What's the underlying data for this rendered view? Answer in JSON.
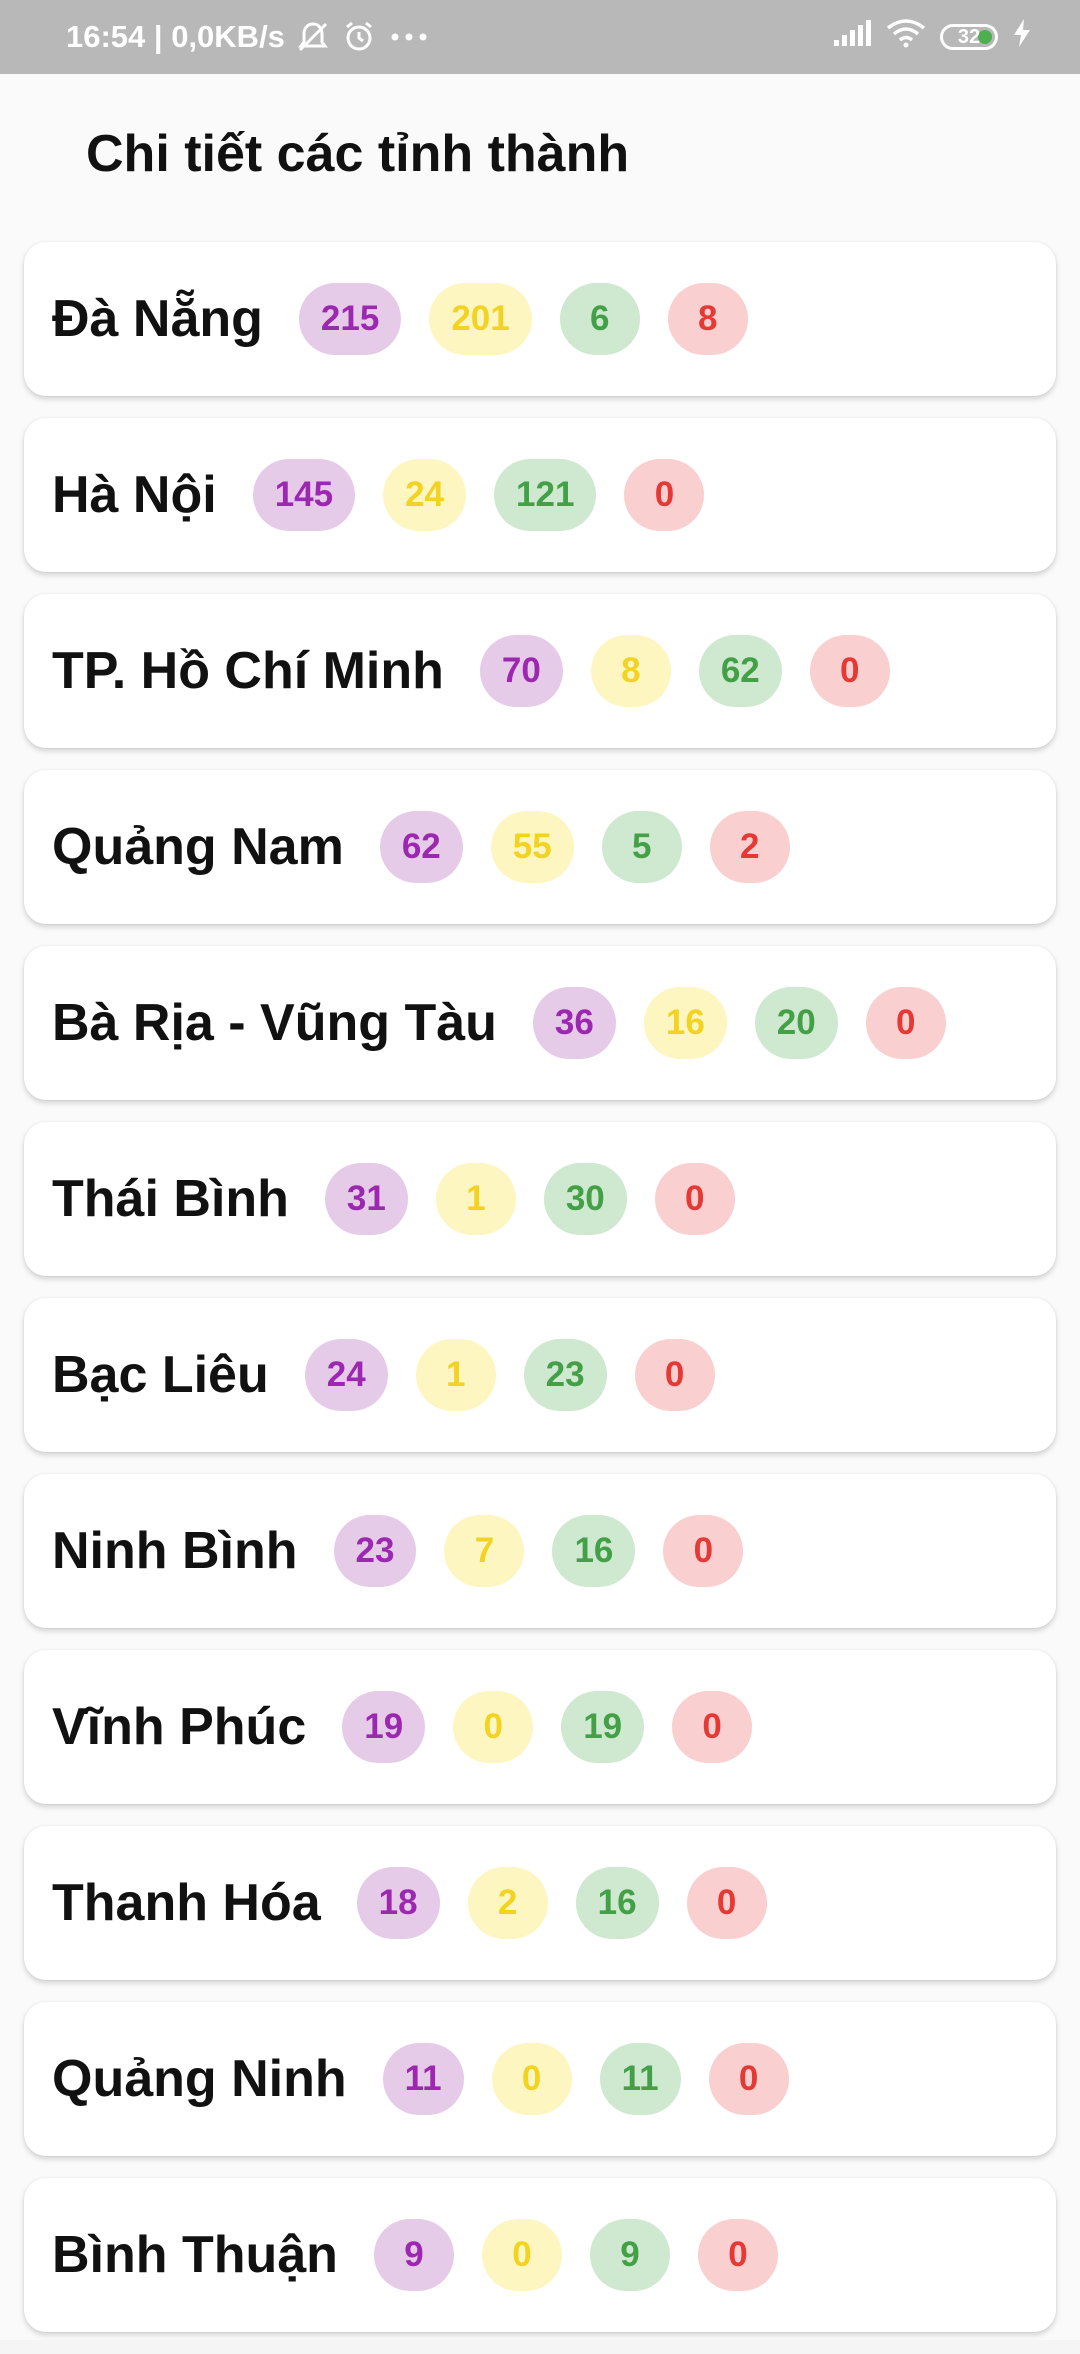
{
  "status_bar": {
    "time": "16:54",
    "network_speed": "0,0KB/s",
    "battery_level": "32",
    "icons": [
      "muted-bell-icon",
      "alarm-icon",
      "more-dots-icon",
      "signal-icon",
      "wifi-icon",
      "battery-icon",
      "charging-bolt-icon"
    ]
  },
  "page": {
    "title": "Chi tiết các tỉnh thành"
  },
  "colors": {
    "total": "#9c27b0",
    "treating": "#f2d321",
    "recovered": "#43a047",
    "deaths": "#e53935"
  },
  "provinces": [
    {
      "name": "Đà Nẵng",
      "total": "215",
      "treating": "201",
      "recovered": "6",
      "deaths": "8"
    },
    {
      "name": "Hà Nội",
      "total": "145",
      "treating": "24",
      "recovered": "121",
      "deaths": "0"
    },
    {
      "name": "TP. Hồ Chí Minh",
      "total": "70",
      "treating": "8",
      "recovered": "62",
      "deaths": "0"
    },
    {
      "name": "Quảng Nam",
      "total": "62",
      "treating": "55",
      "recovered": "5",
      "deaths": "2"
    },
    {
      "name": "Bà Rịa - Vũng Tàu",
      "total": "36",
      "treating": "16",
      "recovered": "20",
      "deaths": "0"
    },
    {
      "name": "Thái Bình",
      "total": "31",
      "treating": "1",
      "recovered": "30",
      "deaths": "0"
    },
    {
      "name": "Bạc Liêu",
      "total": "24",
      "treating": "1",
      "recovered": "23",
      "deaths": "0"
    },
    {
      "name": "Ninh Bình",
      "total": "23",
      "treating": "7",
      "recovered": "16",
      "deaths": "0"
    },
    {
      "name": "Vĩnh Phúc",
      "total": "19",
      "treating": "0",
      "recovered": "19",
      "deaths": "0"
    },
    {
      "name": "Thanh Hóa",
      "total": "18",
      "treating": "2",
      "recovered": "16",
      "deaths": "0"
    },
    {
      "name": "Quảng Ninh",
      "total": "11",
      "treating": "0",
      "recovered": "11",
      "deaths": "0"
    },
    {
      "name": "Bình Thuận",
      "total": "9",
      "treating": "0",
      "recovered": "9",
      "deaths": "0"
    }
  ]
}
